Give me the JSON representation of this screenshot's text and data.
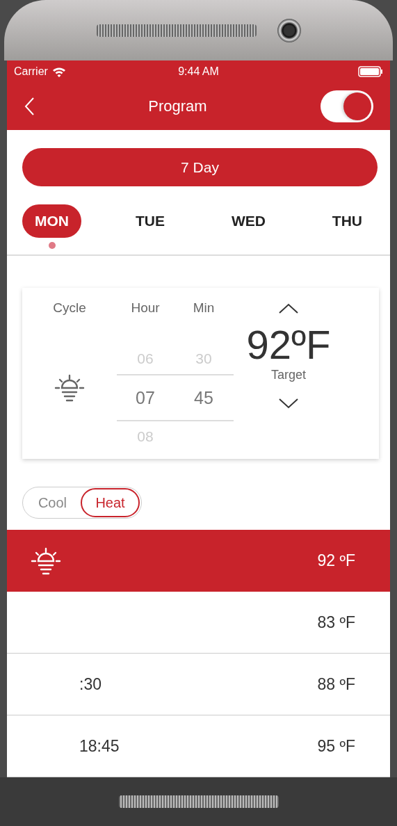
{
  "status_bar": {
    "carrier": "Carrier",
    "time": "9:44 AM"
  },
  "nav": {
    "title": "Program",
    "switch_on": true
  },
  "schedule_button": "7 Day",
  "days": [
    {
      "label": "MON",
      "selected": true
    },
    {
      "label": "TUE",
      "selected": false
    },
    {
      "label": "WED",
      "selected": false
    },
    {
      "label": "THU",
      "selected": false
    }
  ],
  "picker": {
    "headers": [
      "Cycle",
      "Hour",
      "Min"
    ],
    "hours": [
      "06",
      "07",
      "08"
    ],
    "minutes": [
      "30",
      "45"
    ],
    "temperature": "92ºF",
    "target_label": "Target"
  },
  "modes": [
    {
      "label": "Cool",
      "selected": false
    },
    {
      "label": "Heat",
      "selected": true
    }
  ],
  "rows": [
    {
      "time": "",
      "temp": "92 ºF",
      "selected": true,
      "icon": true
    },
    {
      "time": "",
      "temp": "83 ºF",
      "selected": false,
      "icon": false
    },
    {
      "time": ":30",
      "temp": "88 ºF",
      "selected": false,
      "icon": false
    },
    {
      "time": "18:45",
      "temp": "95 ºF",
      "selected": false,
      "icon": false
    }
  ]
}
